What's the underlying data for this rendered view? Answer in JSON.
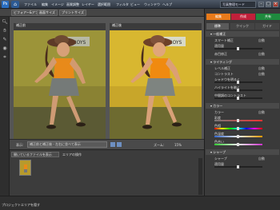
{
  "menubar": {
    "logo": "Ps",
    "home_icon": "home-icon",
    "items": [
      "ファイル",
      "編集",
      "イメージ",
      "画質調整",
      "レイヤー",
      "選択範囲",
      "フィルタ",
      "ビュー",
      "ウィンドウ",
      "ヘルプ"
    ],
    "mode": "写真整理モード"
  },
  "subbar": {
    "before_after": "ビフォアー&アフター",
    "view_size": "画面サイズ",
    "print_size": "プリントサイズ"
  },
  "view": {
    "before_label": "補正前",
    "after_label": "補正後",
    "photo_sign": "COWBOYS"
  },
  "viewctl": {
    "display_label": "表示:",
    "display_value": "補正前と補正後 - 左右に並べて表示",
    "zoom_label": "ズーム:",
    "zoom_value": "15%"
  },
  "bin": {
    "show_files": "開いているファイルを表示",
    "bin_action": "エリアの操作"
  },
  "statusbar": {
    "text": "プロジェクトエリアを隠す"
  },
  "rpanel": {
    "tabs": [
      "編集",
      "作成",
      "共有"
    ],
    "tab_colors": [
      "#e87a1a",
      "#c0203a",
      "#1f8a3e"
    ],
    "mode_tabs": [
      "標準",
      "クイック",
      "ガイド"
    ],
    "sections": [
      {
        "title": "一般補正",
        "rows": [
          {
            "label": "スマート補正",
            "value": "自動"
          },
          {
            "label": "適用量",
            "value": ""
          },
          {
            "label": "赤目修正",
            "value": "自動"
          }
        ]
      },
      {
        "title": "ライティング",
        "rows": [
          {
            "label": "レベル補正",
            "value": "自動"
          },
          {
            "label": "コントラスト",
            "value": "自動"
          },
          {
            "label": "シャドウを明るく",
            "value": ""
          },
          {
            "label": "ハイライトを暗く",
            "value": ""
          },
          {
            "label": "中間調のコントラスト",
            "value": ""
          }
        ]
      },
      {
        "title": "カラー",
        "rows": [
          {
            "label": "カラー",
            "value": "自動"
          },
          {
            "label": "彩度",
            "value": ""
          },
          {
            "label": "色相",
            "value": ""
          },
          {
            "label": "色温度",
            "value": ""
          },
          {
            "label": "色合い",
            "value": ""
          }
        ]
      },
      {
        "title": "シャープ",
        "rows": [
          {
            "label": "シャープ",
            "value": "自動"
          },
          {
            "label": "適用量",
            "value": ""
          }
        ]
      }
    ]
  }
}
